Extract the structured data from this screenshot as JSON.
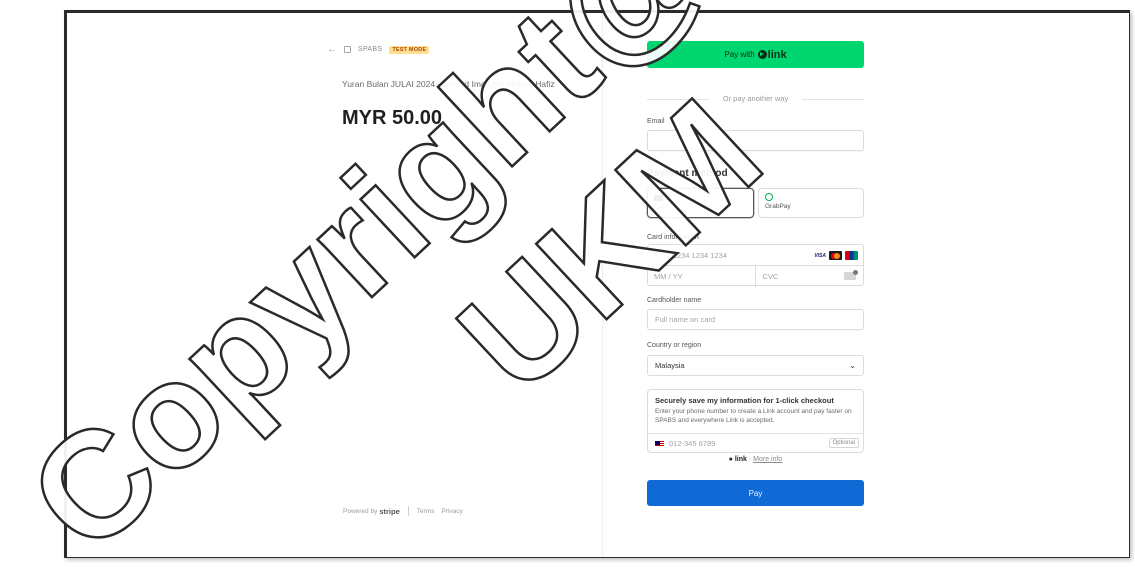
{
  "header": {
    "back_icon": "arrow-left-icon",
    "store_icon": "store-icon",
    "merchant_name": "SPABS",
    "test_badge": "TEST MODE"
  },
  "order": {
    "product_name": "Yuran Bulan JULAI 2024 - Ahmad Iman bin Ahmad Hafiz",
    "amount": "MYR 50.00"
  },
  "footer": {
    "powered_by": "Powered by",
    "brand": "stripe",
    "terms": "Terms",
    "privacy": "Privacy"
  },
  "checkout": {
    "pay_with": "Pay with",
    "link_label": "link",
    "or_pay": "Or pay another way",
    "email_label": "Email",
    "email_value": "",
    "payment_method_title": "Payment method",
    "methods": [
      {
        "label": "Card",
        "icon": "card-icon",
        "selected": true
      },
      {
        "label": "GrabPay",
        "icon": "grabpay-icon",
        "selected": false
      }
    ],
    "card_info_label": "Card information",
    "card_number_placeholder": "1234 1234 1234 1234",
    "card_brands": [
      "visa-icon",
      "mastercard-icon",
      "unionpay-icon"
    ],
    "visa_text": "VISA",
    "expiry_placeholder": "MM / YY",
    "cvc_placeholder": "CVC",
    "cardholder_label": "Cardholder name",
    "cardholder_placeholder": "Full name on card",
    "country_label": "Country or region",
    "country_value": "Malaysia",
    "save_title": "Securely save my information for 1-click checkout",
    "save_desc": "Enter your phone number to create a Link account and pay faster on SPABS and everywhere Link is accepted.",
    "phone_placeholder": "012-345 6789",
    "optional_label": "Optional",
    "link_word": "link",
    "more_info": "More info",
    "pay_button": "Pay"
  },
  "watermark": {
    "line1": "Copyright@",
    "line2": "UKM"
  },
  "colors": {
    "link_green": "#00d66f",
    "pay_blue": "#0f6ad6",
    "test_badge_bg": "#ffde92"
  }
}
